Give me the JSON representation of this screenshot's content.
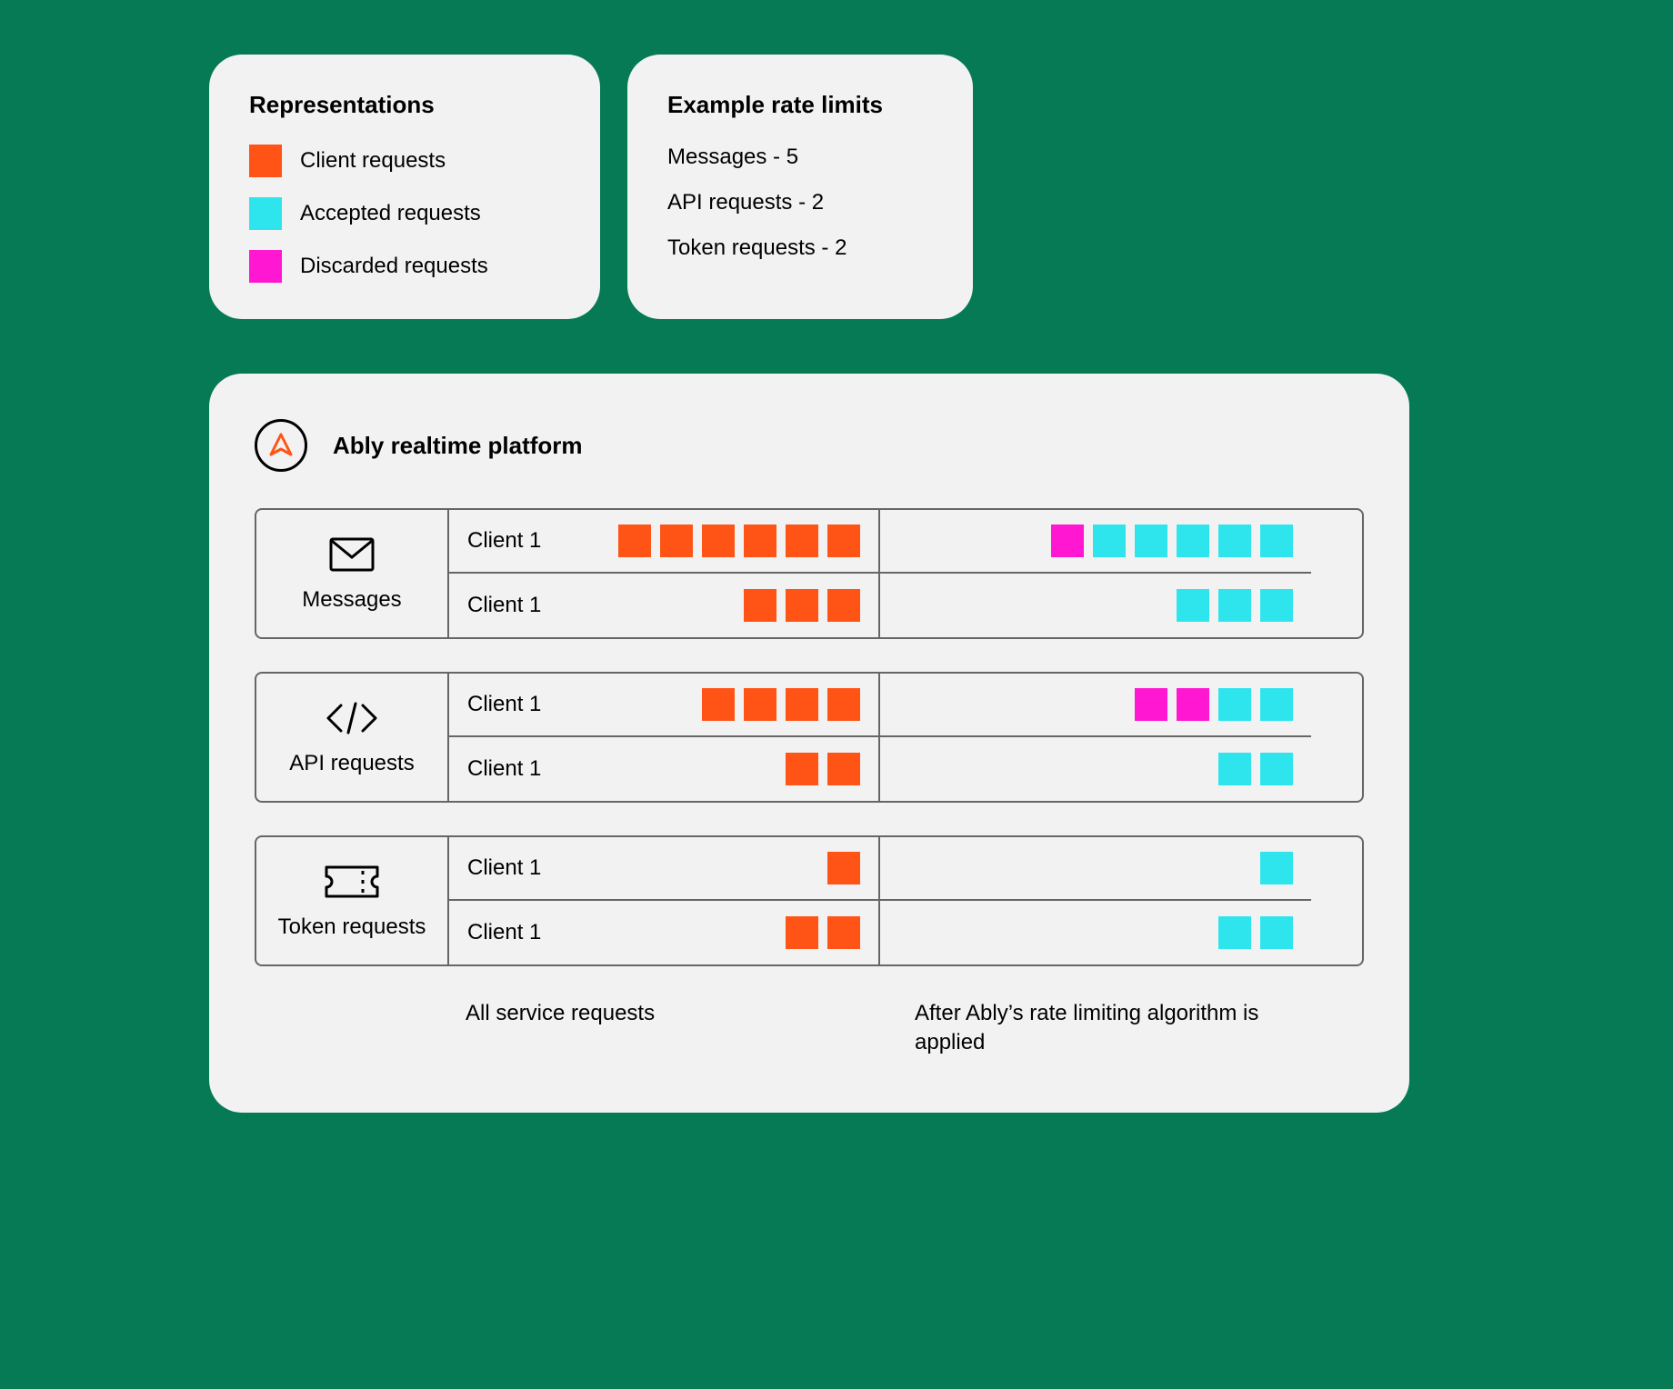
{
  "colors": {
    "client": "#ff5416",
    "accepted": "#2ee5ee",
    "discarded": "#ff17d2"
  },
  "legend": {
    "title": "Representations",
    "items": [
      {
        "label": "Client requests",
        "color": "orange"
      },
      {
        "label": "Accepted requests",
        "color": "cyan"
      },
      {
        "label": "Discarded requests",
        "color": "magenta"
      }
    ]
  },
  "limits": {
    "title": "Example rate limits",
    "items": [
      {
        "label": "Messages",
        "value": 5
      },
      {
        "label": "API requests",
        "value": 2
      },
      {
        "label": "Token requests",
        "value": 2
      }
    ]
  },
  "platform": {
    "title": "Ably realtime platform",
    "captions": {
      "before": "All service requests",
      "after": "After Ably’s rate limiting algorithm is applied"
    },
    "sections": [
      {
        "name": "Messages",
        "icon": "envelope-icon",
        "rows": [
          {
            "label": "Client 1",
            "before": [
              "orange",
              "orange",
              "orange",
              "orange",
              "orange",
              "orange"
            ],
            "after": [
              "magenta",
              "cyan",
              "cyan",
              "cyan",
              "cyan",
              "cyan"
            ]
          },
          {
            "label": "Client 1",
            "before": [
              "orange",
              "orange",
              "orange"
            ],
            "after": [
              "cyan",
              "cyan",
              "cyan"
            ]
          }
        ]
      },
      {
        "name": "API requests",
        "icon": "code-icon",
        "rows": [
          {
            "label": "Client 1",
            "before": [
              "orange",
              "orange",
              "orange",
              "orange"
            ],
            "after": [
              "magenta",
              "magenta",
              "cyan",
              "cyan"
            ]
          },
          {
            "label": "Client 1",
            "before": [
              "orange",
              "orange"
            ],
            "after": [
              "cyan",
              "cyan"
            ]
          }
        ]
      },
      {
        "name": "Token requests",
        "icon": "ticket-icon",
        "rows": [
          {
            "label": "Client 1",
            "before": [
              "orange"
            ],
            "after": [
              "cyan"
            ]
          },
          {
            "label": "Client 1",
            "before": [
              "orange",
              "orange"
            ],
            "after": [
              "cyan",
              "cyan"
            ]
          }
        ]
      }
    ]
  }
}
